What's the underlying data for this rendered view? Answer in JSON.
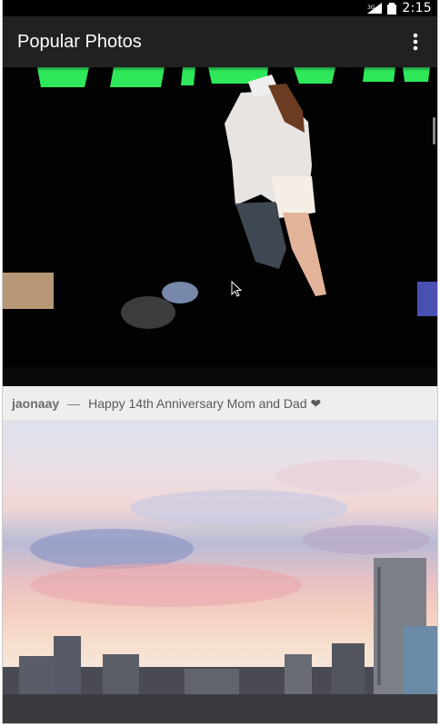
{
  "statusbar": {
    "time": "2:15",
    "network": "3G"
  },
  "actionbar": {
    "title": "Popular Photos"
  },
  "feed": {
    "items": [
      {
        "username": "jaonaay",
        "separator": "—",
        "caption": "Happy 14th Anniversary Mom and Dad ❤"
      }
    ]
  },
  "colors": {
    "actionbar": "#212121",
    "statusbar": "#000000",
    "caption_bg": "#eeeeee",
    "stage_green": "#2ee85a"
  }
}
